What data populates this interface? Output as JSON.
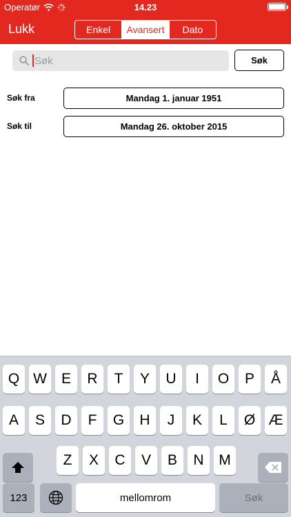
{
  "status_bar": {
    "carrier": "Operatør",
    "time": "14.23"
  },
  "nav": {
    "close_label": "Lukk",
    "tabs": [
      {
        "label": "Enkel",
        "active": false
      },
      {
        "label": "Avansert",
        "active": true
      },
      {
        "label": "Dato",
        "active": false
      }
    ]
  },
  "search": {
    "placeholder": "Søk",
    "value": "",
    "button_label": "Søk"
  },
  "date_range": {
    "from_label": "Søk fra",
    "from_value": "Mandag 1. januar 1951",
    "to_label": "Søk til",
    "to_value": "Mandag 26. oktober 2015"
  },
  "keyboard": {
    "row1": [
      "Q",
      "W",
      "E",
      "R",
      "T",
      "Y",
      "U",
      "I",
      "O",
      "P",
      "Å"
    ],
    "row2": [
      "A",
      "S",
      "D",
      "F",
      "G",
      "H",
      "J",
      "K",
      "L",
      "Ø",
      "Æ"
    ],
    "row3": [
      "Z",
      "X",
      "C",
      "V",
      "B",
      "N",
      "M"
    ],
    "numbers_label": "123",
    "space_label": "mellomrom",
    "return_label": "Søk"
  },
  "colors": {
    "accent": "#e3281f",
    "keyboard_bg": "#d2d5db",
    "dark_key": "#abb0ba"
  },
  "icons": [
    "wifi-icon",
    "activity-spinner-icon",
    "battery-icon",
    "search-icon",
    "shift-icon",
    "backspace-icon",
    "globe-icon"
  ]
}
